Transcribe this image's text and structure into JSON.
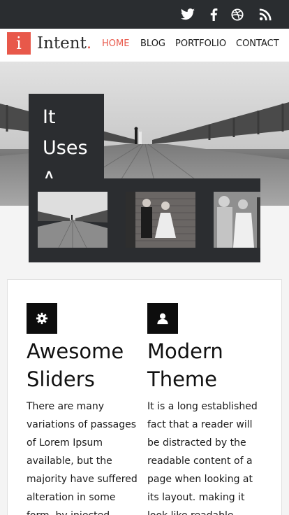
{
  "social": {
    "icons": [
      "twitter-icon",
      "facebook-icon",
      "dribbble-icon",
      "rss-icon"
    ]
  },
  "brand": {
    "mark": "i",
    "name": "Intent",
    "dot": ".",
    "accent": "#e8584a"
  },
  "nav": {
    "home": "HOME",
    "blog": "BLOG",
    "portfolio": "PORTFOLIO",
    "contact": "CONTACT"
  },
  "slider": {
    "caption": "It Uses A"
  },
  "features": [
    {
      "icon": "gear-icon",
      "title": "Awesome Sliders",
      "text": "There are many variations of passages of Lorem Ipsum available, but the majority have suffered alteration in some form, by injected"
    },
    {
      "icon": "user-icon",
      "title": "Modern Theme",
      "text": "It is a long established fact that a reader will be distracted by the readable content of a page when looking at its layout. making it look like readable"
    }
  ]
}
